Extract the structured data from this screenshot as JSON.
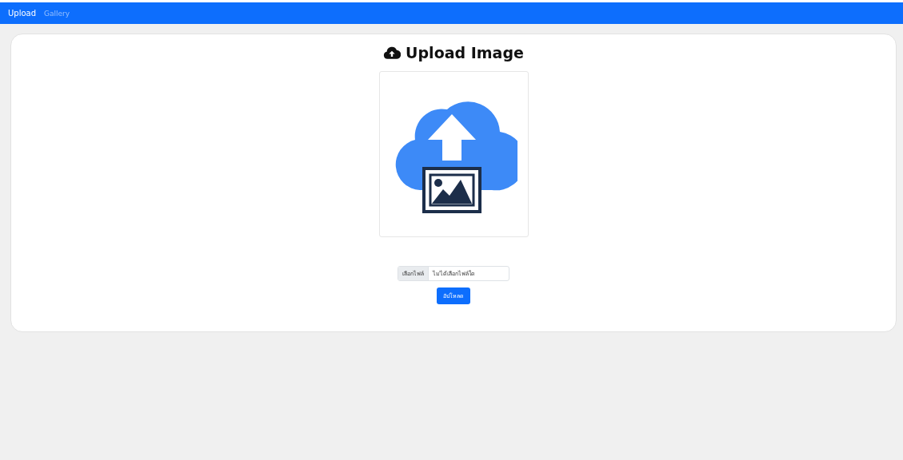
{
  "navbar": {
    "items": [
      {
        "label": "Upload",
        "selected": true
      },
      {
        "label": "Gallery",
        "selected": false
      }
    ]
  },
  "card": {
    "title": "Upload Image"
  },
  "file_input": {
    "button": "เลือกไฟล์",
    "value": "ไม่ได้เลือกไฟล์ใด"
  },
  "submit_button": "อัปโหลด"
}
